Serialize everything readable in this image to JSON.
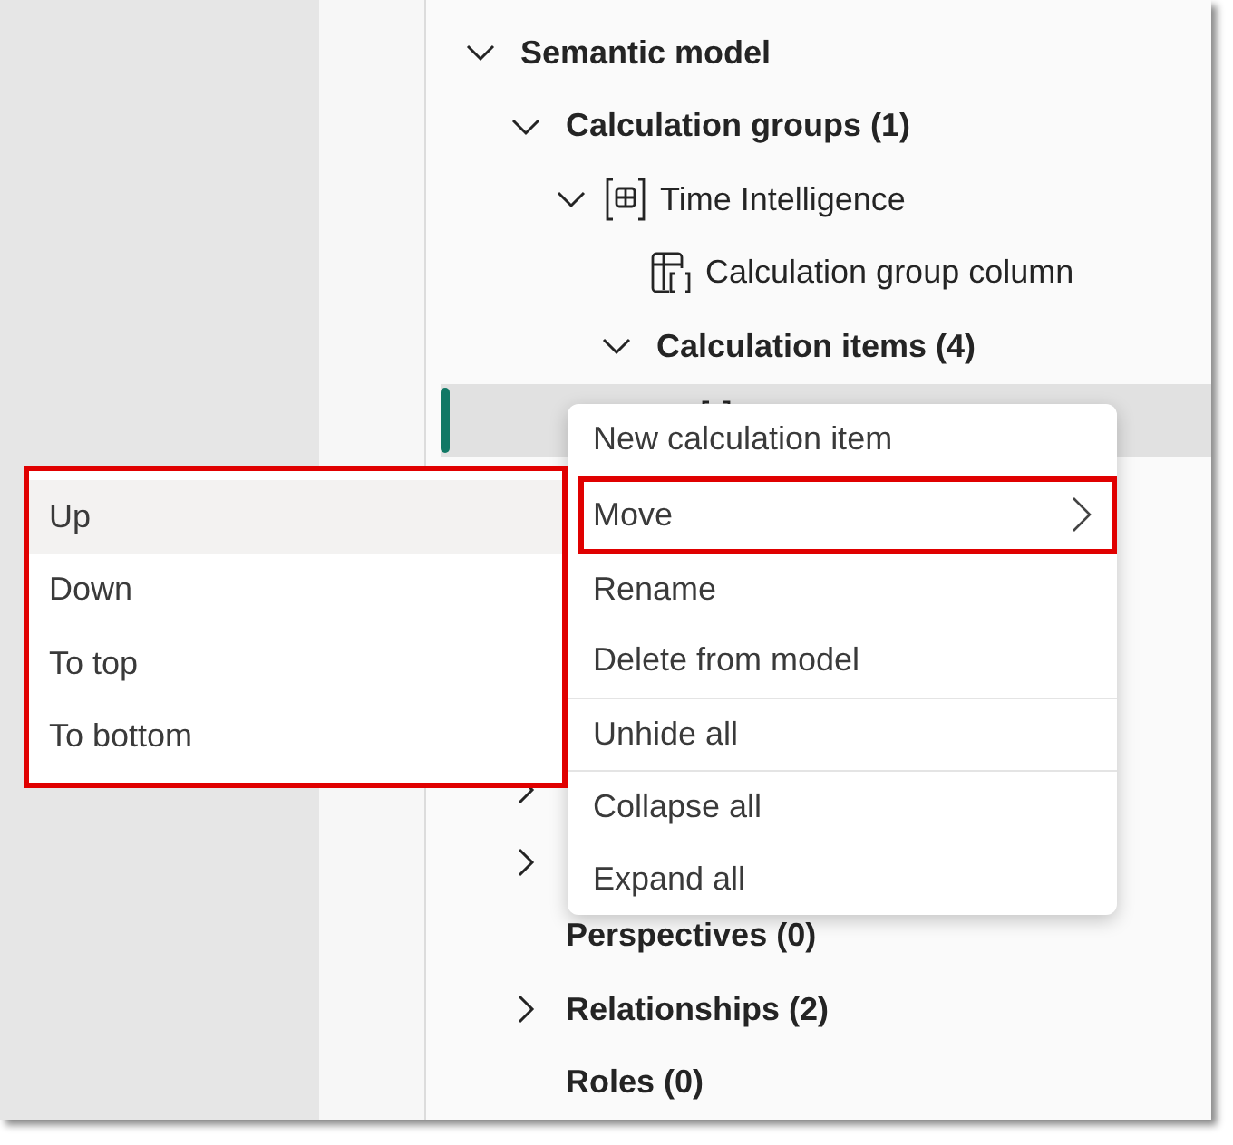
{
  "tree": {
    "label": "Semantic model",
    "expanded": true,
    "children": [
      {
        "label": "Calculation groups (1)",
        "expanded": true,
        "children": [
          {
            "label": "Time Intelligence",
            "expanded": true,
            "kind": "calc-group",
            "children": [
              {
                "label": "Calculation group column",
                "kind": "column"
              },
              {
                "label": "Calculation items (4)",
                "expanded": true,
                "children": [
                  {
                    "kind": "calc-item",
                    "selected": true
                  }
                ]
              }
            ]
          }
        ]
      }
    ]
  },
  "tree_continued": [
    {
      "expanded": false
    },
    {
      "expanded": false
    },
    {
      "label": "Perspectives (0)"
    },
    {
      "label": "Relationships (2)",
      "expanded": false
    },
    {
      "label": "Roles (0)"
    }
  ],
  "context_menu": {
    "groups": [
      [
        {
          "label": "New calculation item",
          "submenu": false,
          "highlighted": false
        },
        {
          "label": "Move",
          "submenu": true,
          "highlighted": true
        },
        {
          "label": "Rename",
          "submenu": false,
          "highlighted": false
        },
        {
          "label": "Delete from model",
          "submenu": false,
          "highlighted": false
        }
      ],
      [
        {
          "label": "Unhide all",
          "submenu": false,
          "highlighted": false
        }
      ],
      [
        {
          "label": "Collapse all",
          "submenu": false,
          "highlighted": false
        },
        {
          "label": "Expand all",
          "submenu": false,
          "highlighted": false
        }
      ]
    ]
  },
  "submenu": {
    "highlighted": true,
    "items": [
      {
        "label": "Up",
        "hovered": true
      },
      {
        "label": "Down",
        "hovered": false
      },
      {
        "label": "To top",
        "hovered": false
      },
      {
        "label": "To bottom",
        "hovered": false
      }
    ]
  }
}
